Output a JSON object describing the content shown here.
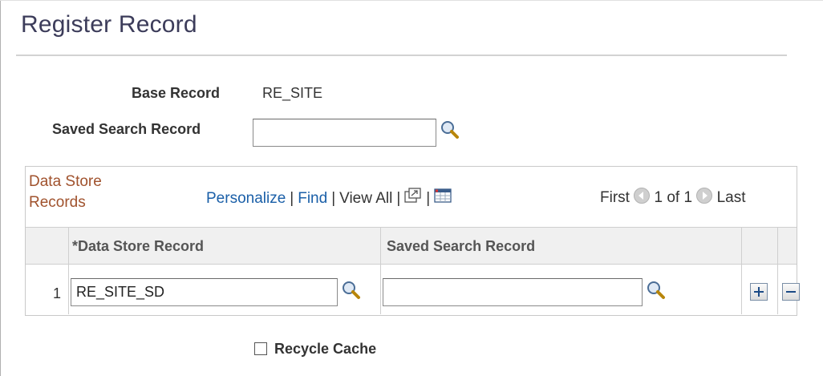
{
  "page": {
    "title": "Register Record"
  },
  "form": {
    "base_record_label": "Base Record",
    "base_record_value": "RE_SITE",
    "saved_search_label": "Saved Search Record",
    "saved_search_value": ""
  },
  "grid": {
    "caption_line1": "Data Store",
    "caption_line2": "Records",
    "links": {
      "personalize": "Personalize",
      "find": "Find",
      "view_all": "View All"
    },
    "separator": "|",
    "pager": {
      "first": "First",
      "range": "1 of 1",
      "last": "Last"
    },
    "columns": [
      "*Data Store Record",
      "Saved Search Record"
    ],
    "rows": [
      {
        "num": "1",
        "data_store_record": "RE_SITE_SD",
        "saved_search_record": ""
      }
    ]
  },
  "options": {
    "recycle_cache_label": "Recycle Cache",
    "recycle_cache_checked": false
  },
  "icons": {
    "lookup": "magnifier-icon",
    "zoom": "zoom-window-icon",
    "download": "spreadsheet-icon",
    "prev": "previous-arrow-icon",
    "next": "next-arrow-icon",
    "add": "plus-icon",
    "delete": "minus-icon"
  },
  "colors": {
    "link": "#1a5fa8",
    "caption": "#a0522d",
    "title": "#3c3c5a"
  }
}
